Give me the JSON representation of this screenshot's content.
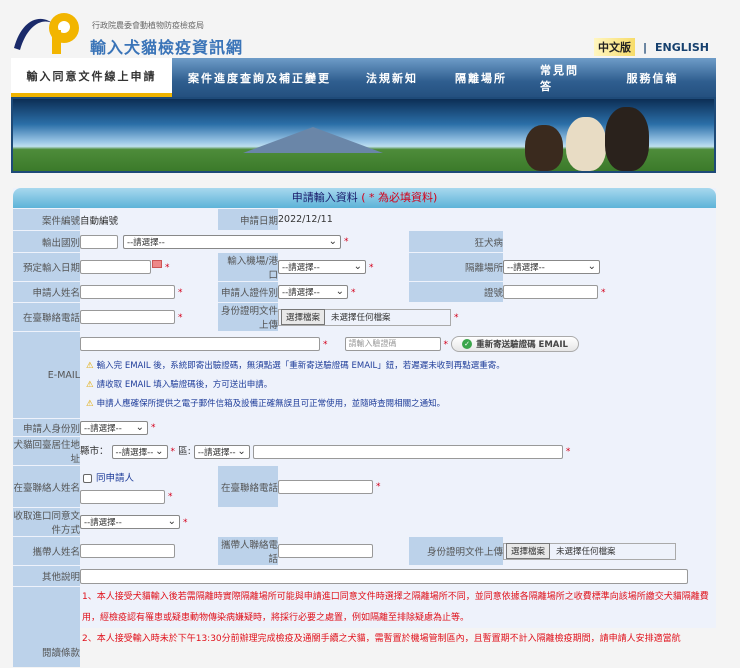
{
  "header": {
    "agency": "行政院農委會動植物防疫檢疫局",
    "title": "輸入犬貓檢疫資訊網",
    "lang_zh": "中文版",
    "lang_sep": "|",
    "lang_en": "ENGLISH"
  },
  "nav": [
    "輸入同意文件線上申請",
    "案件進度查詢及補正變更",
    "法規新知",
    "隔離場所",
    "常見問答",
    "服務信箱"
  ],
  "form": {
    "title": "申請輸入資料",
    "title_req_open": "( * ",
    "title_req": "為必填資料)",
    "case_no_label": "案件編號",
    "case_no_value": "自動編號",
    "apply_date_label": "申請日期",
    "apply_date_value": "2022/12/11",
    "export_country_label": "輸出國別",
    "select_placeholder": "--請選擇--",
    "rabies_label": "狂犬病",
    "arrival_date_label": "預定輸入日期",
    "port_label": "輸入機場/港口",
    "quarantine_label": "隔離場所",
    "name_label": "申請人姓名",
    "id_type_label": "申請人證件別",
    "id_no_label": "證號",
    "phone_label": "在臺聯絡電話",
    "id_upload_label": "身份證明文件上傳",
    "choose_file": "選擇檔案",
    "no_file": "未選擇任何檔案",
    "email_label": "E-MAIL",
    "verify_placeholder": "請輸入驗證碼",
    "resend_label": "重新寄送驗證碼 EMAIL",
    "email_notes": [
      "輸入完 EMAIL 後，系統即寄出驗證碼，無須點選「重新寄送驗證碼 EMAIL」鈕，若遲遲未收到再點選重寄。",
      "請收取 EMAIL 填入驗證碼後，方可送出申請。",
      "申請人應確保所提供之電子郵件信箱及設備正確無誤且可正常使用，並隨時查閱相關之通知。"
    ],
    "identity_label": "申請人身份別",
    "address_label": "犬貓回臺居住地址",
    "city_label": "縣市：",
    "district_label": "區:",
    "contact_name_label": "在臺聯絡人姓名",
    "same_as_applicant": "同申請人",
    "contact_phone_label": "在臺聯絡電話",
    "receive_label": "收取進口同意文件方式",
    "carrier_name_label": "攜帶人姓名",
    "carrier_phone_label": "攜帶人聯絡電話",
    "carrier_id_upload_label": "身份證明文件上傳",
    "other_label": "其他說明",
    "terms_label": "閱讀條款",
    "terms": [
      "1、本人接受犬貓輸入後若需隔離時實際隔離場所可能與申請進口同意文件時選擇之隔離場所不同，並同意依據各隔離場所之收費標準向該場所繳交犬貓隔離費用，經檢疫認有罹患或疑患動物傳染病嫌疑時，將採行必要之處置，例如隔離至排除疑慮為止等。",
      "2、本人接受輸入時未於下午13:30分前辦理完成檢疫及通關手續之犬貓，需暫置於機場管制區內，且暫置期不計入隔離檢疫期間，請申請人安排適當航"
    ]
  }
}
